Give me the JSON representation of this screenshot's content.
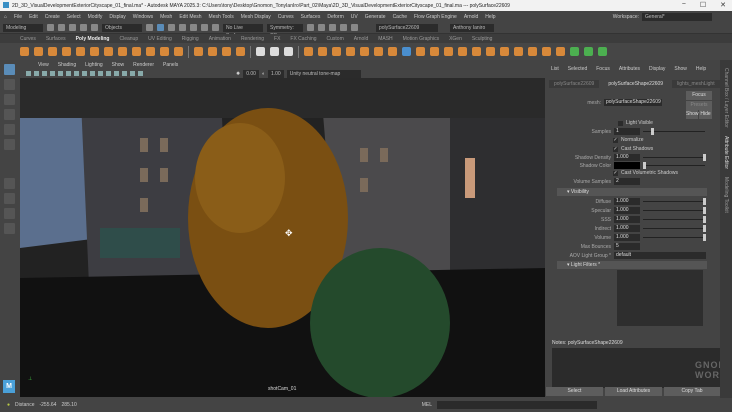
{
  "title": "2D_3D_VisualDevelopmentExteriorCityscape_01_final.ma* - Autodesk MAYA 2025.3: C:\\Users\\tony\\Desktop\\Gnomon_TonyIanIro\\Part_02\\Maya\\2D_3D_VisualDevelopmentExteriorCityscape_01_final.ma --- polySurface22609",
  "window_buttons": [
    "−",
    "☐",
    "✕"
  ],
  "menu": [
    "File",
    "Edit",
    "Create",
    "Select",
    "Modify",
    "Display",
    "Windows",
    "Mesh",
    "Edit Mesh",
    "Mesh Tools",
    "Mesh Display",
    "Curves",
    "Surfaces",
    "Deform",
    "UV",
    "Generate",
    "Cache",
    "Flow Graph Engine",
    "Arnold",
    "Help"
  ],
  "workspace_label": "Workspace:",
  "workspace_value": "General*",
  "status": {
    "mode": "Modeling",
    "objects": "Objects",
    "live_surface": "No Live Surface",
    "symmetry": "Symmetry: Off",
    "name_field": "polySurface22609",
    "user": "Anthony Ianiro"
  },
  "shelf_tabs": [
    "Curves",
    "Surfaces",
    "Poly Modeling",
    "Cleanup",
    "UV Editing",
    "Rigging",
    "Animation",
    "Rendering",
    "FX",
    "FX Caching",
    "Custom",
    "Arnold",
    "MASH",
    "Motion Graphics",
    "XGen",
    "Sculpting"
  ],
  "shelf_active": "Poly Modeling",
  "viewport": {
    "menu": [
      "View",
      "Shading",
      "Lighting",
      "Show",
      "Renderer",
      "Panels"
    ],
    "exposure": "0.00",
    "gamma": "1.00",
    "colorspace": "Unity neutral tone-map (sRGB)",
    "camera": "shotCam_01"
  },
  "ae": {
    "menu": [
      "List",
      "Selected",
      "Focus",
      "Attributes",
      "Display",
      "Show",
      "Help"
    ],
    "tabs": [
      "polySurface22609",
      "polySurfaceShape22609",
      "lights_meshLight",
      "ra_ligh"
    ],
    "mesh_label": "mesh:",
    "mesh_value": "polySurfaceShape22609",
    "focus": "Focus",
    "presets": "Presets",
    "show": "Show",
    "hide": "Hide",
    "light_visible": "Light Visible",
    "samples_label": "Samples",
    "samples": "1",
    "normalize": "Normalize",
    "cast_shadows": "Cast Shadows",
    "shadow_density_label": "Shadow Density",
    "shadow_density": "1.000",
    "shadow_color_label": "Shadow Color",
    "cast_vol": "Cast Volumetric Shadows",
    "volume_samples_label": "Volume Samples",
    "volume_samples": "2",
    "visibility": "Visibility",
    "vis": [
      {
        "label": "Diffuse",
        "value": "1.000"
      },
      {
        "label": "Specular",
        "value": "1.000"
      },
      {
        "label": "SSS",
        "value": "1.000"
      },
      {
        "label": "Indirect",
        "value": "1.000"
      },
      {
        "label": "Volume",
        "value": "1.000"
      }
    ],
    "max_bounces_label": "Max Bounces",
    "max_bounces": "5",
    "aov_label": "AOV Light Group *",
    "aov": "default",
    "light_filters": "Light Filters *",
    "notes": "Notes:  polySurfaceShape22609",
    "select": "Select",
    "load": "Load Attributes",
    "copy": "Copy Tab"
  },
  "side_tabs": [
    "Channel Box / Layer Editor",
    "Attribute Editor",
    "Modeling Toolkit"
  ],
  "bottom": {
    "distance_label": "Distance",
    "distance": "-255.64",
    "value2": "285.10",
    "mel": "MEL"
  },
  "watermark": "THE GNOMON WORKSHOP"
}
